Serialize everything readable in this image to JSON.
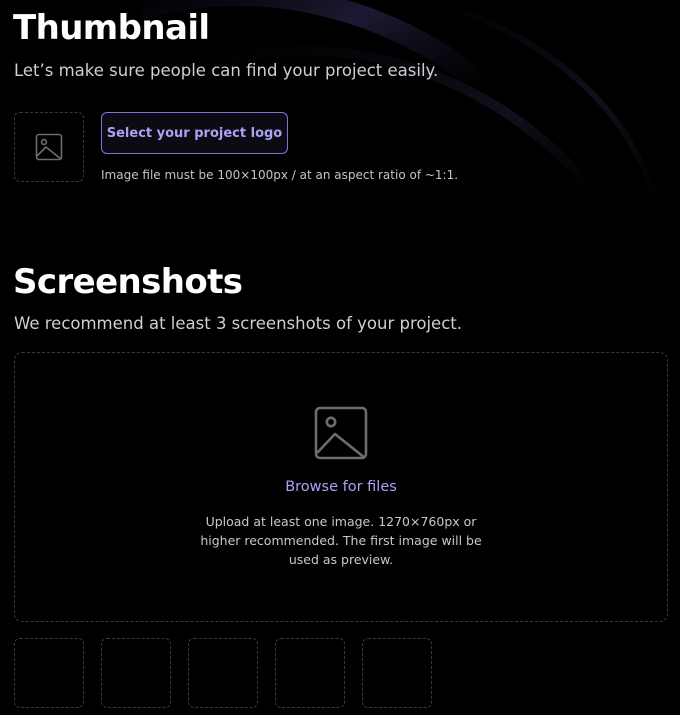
{
  "colors": {
    "background": "#000000",
    "accent": "#aaa3f5",
    "accent_border": "#7c74d6",
    "dashed_border": "#3a3a3e",
    "text_primary": "#ffffff",
    "text_secondary": "#cfcfd4"
  },
  "thumbnail": {
    "title": "Thumbnail",
    "subtitle": "Let’s make sure people can find your project easily.",
    "placeholder_icon": "image-icon",
    "select_button_label": "Select your project logo",
    "hint": "Image file must be 100×100px / at an aspect ratio of ~1:1."
  },
  "screenshots": {
    "title": "Screenshots",
    "subtitle": "We recommend at least 3 screenshots of your project.",
    "dropzone_icon": "image-icon",
    "browse_label": "Browse for files",
    "description": "Upload at least one image. 1270×760px or higher recommended. The first image will be used as preview.",
    "slot_count": 5
  }
}
